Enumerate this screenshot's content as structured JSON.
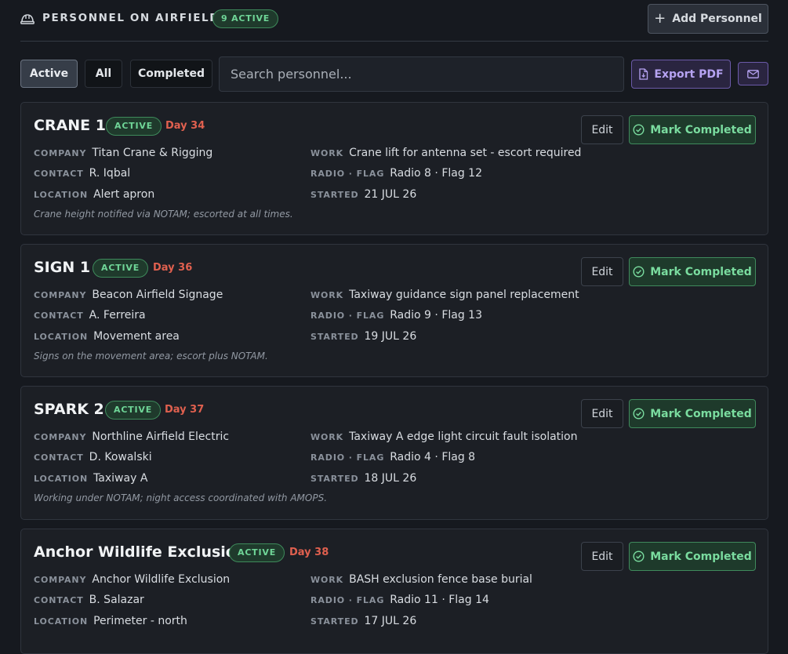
{
  "header": {
    "title": "PERSONNEL ON AIRFIELD",
    "active_count": "9 ACTIVE",
    "add_label": "Add Personnel",
    "add_icon": "plus-icon"
  },
  "toolbar": {
    "filters": [
      "Active",
      "All",
      "Completed"
    ],
    "selected_filter": "Active",
    "search_placeholder": "Search personnel...",
    "search_value": "",
    "export_label": "Export PDF",
    "export_icon": "pdf-icon",
    "mail_icon": "mail-icon"
  },
  "colors": {
    "accent_green": "#6fd597",
    "accent_purple": "#b6a3f2",
    "day_red": "#e0604f",
    "background": "#16191f"
  },
  "labels": {
    "company": "COMPANY",
    "contact": "CONTACT",
    "location": "LOCATION",
    "work": "WORK",
    "radio_flag": "RADIO · FLAG",
    "started": "STARTED",
    "edit": "Edit",
    "mark_completed": "Mark Completed"
  },
  "cards": [
    {
      "name": "CRANE 1",
      "status": "ACTIVE",
      "day": "Day 34",
      "company": "Titan Crane & Rigging",
      "contact": "R. Iqbal",
      "location": "Alert apron",
      "work": "Crane lift for antenna set - escort required",
      "radio_flag": "Radio 8 · Flag 12",
      "started": "21 JUL 26",
      "note": "Crane height notified via NOTAM; escorted at all times."
    },
    {
      "name": "SIGN 1",
      "status": "ACTIVE",
      "day": "Day 36",
      "company": "Beacon Airfield Signage",
      "contact": "A. Ferreira",
      "location": "Movement area",
      "work": "Taxiway guidance sign panel replacement",
      "radio_flag": "Radio 9 · Flag 13",
      "started": "19 JUL 26",
      "note": "Signs on the movement area; escort plus NOTAM."
    },
    {
      "name": "SPARK 2",
      "status": "ACTIVE",
      "day": "Day 37",
      "company": "Northline Airfield Electric",
      "contact": "D. Kowalski",
      "location": "Taxiway A",
      "work": "Taxiway A edge light circuit fault isolation",
      "radio_flag": "Radio 4 · Flag 8",
      "started": "18 JUL 26",
      "note": "Working under NOTAM; night access coordinated with AMOPS."
    },
    {
      "name": "Anchor Wildlife Exclusion",
      "status": "ACTIVE",
      "day": "Day 38",
      "company": "Anchor Wildlife Exclusion",
      "contact": "B. Salazar",
      "location": "Perimeter - north",
      "work": "BASH exclusion fence base burial",
      "radio_flag": "Radio 11 · Flag 14",
      "started": "17 JUL 26",
      "note": ""
    }
  ]
}
